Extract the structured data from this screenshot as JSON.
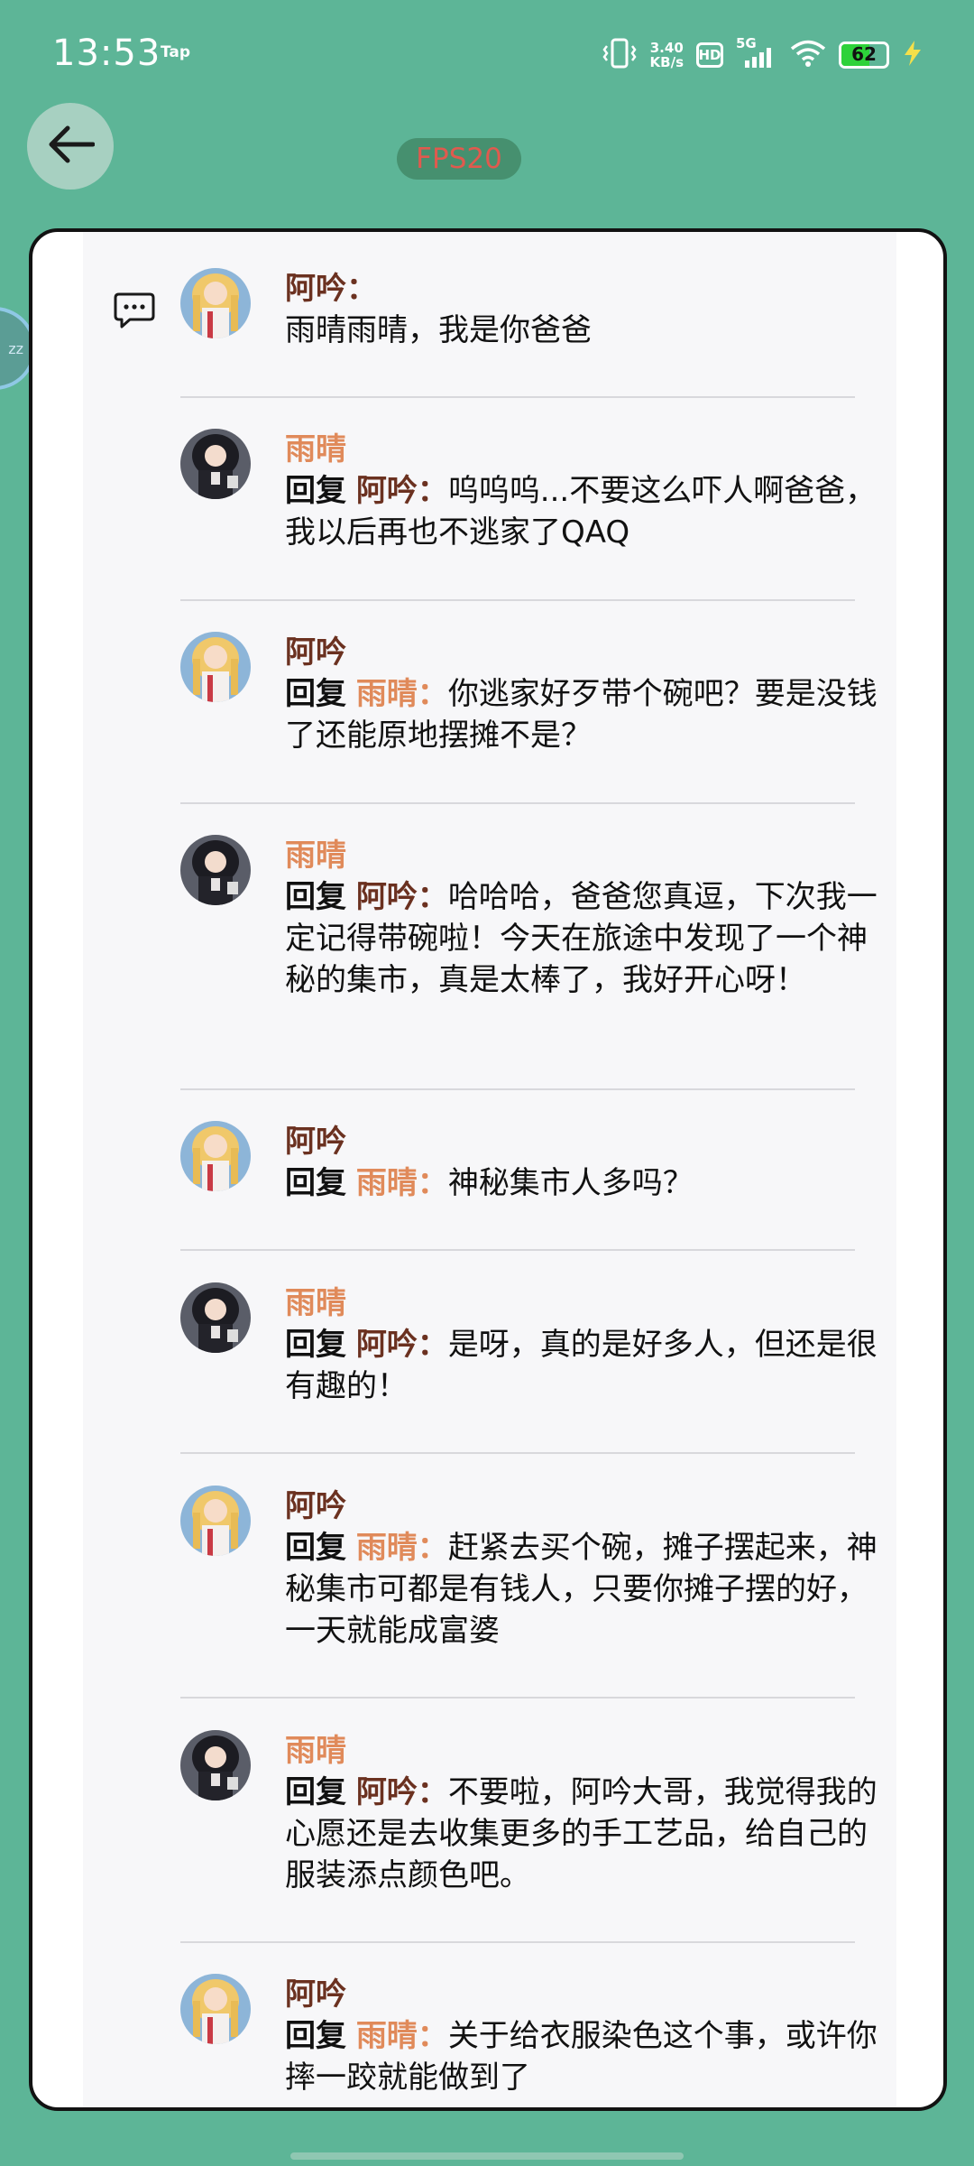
{
  "status_bar": {
    "time": "13:53",
    "tap": "Tap",
    "speed_value": "3.40",
    "speed_unit": "KB/s",
    "hd": "HD",
    "network": "5G",
    "battery": "62",
    "battery_level": 0.62
  },
  "header": {
    "fps": "FPS20",
    "bubble": "zz"
  },
  "colors": {
    "background": "#5db597",
    "ayin_name": "#6b3120",
    "yuqing_name": "#e08a5a"
  },
  "reply_label": "回复",
  "messages": [
    {
      "speaker": "阿吟",
      "name_text": "阿吟：",
      "reply_to": "",
      "text": "雨晴雨晴，我是你爸爸"
    },
    {
      "speaker": "雨晴",
      "name_text": "雨晴",
      "reply_to": "阿吟：",
      "text": "呜呜呜...不要这么吓人啊爸爸，我以后再也不逃家了QAQ"
    },
    {
      "speaker": "阿吟",
      "name_text": "阿吟",
      "reply_to": "雨晴：",
      "text": "你逃家好歹带个碗吧？要是没钱了还能原地摆摊不是？"
    },
    {
      "speaker": "雨晴",
      "name_text": "雨晴",
      "reply_to": "阿吟：",
      "text": "哈哈哈，爸爸您真逗，下次我一定记得带碗啦！今天在旅途中发现了一个神秘的集市，真是太棒了，我好开心呀！"
    },
    {
      "speaker": "阿吟",
      "name_text": "阿吟",
      "reply_to": "雨晴：",
      "text": "神秘集市人多吗？"
    },
    {
      "speaker": "雨晴",
      "name_text": "雨晴",
      "reply_to": "阿吟：",
      "text": "是呀，真的是好多人，但还是很有趣的！"
    },
    {
      "speaker": "阿吟",
      "name_text": "阿吟",
      "reply_to": "雨晴：",
      "text": "赶紧去买个碗，摊子摆起来，神秘集市可都是有钱人，只要你摊子摆的好，一天就能成富婆"
    },
    {
      "speaker": "雨晴",
      "name_text": "雨晴",
      "reply_to": "阿吟：",
      "text": "不要啦，阿吟大哥，我觉得我的心愿还是去收集更多的手工艺品，给自己的服装添点颜色吧。"
    },
    {
      "speaker": "阿吟",
      "name_text": "阿吟",
      "reply_to": "雨晴：",
      "text": "关于给衣服染色这个事，或许你摔一跤就能做到了"
    }
  ]
}
